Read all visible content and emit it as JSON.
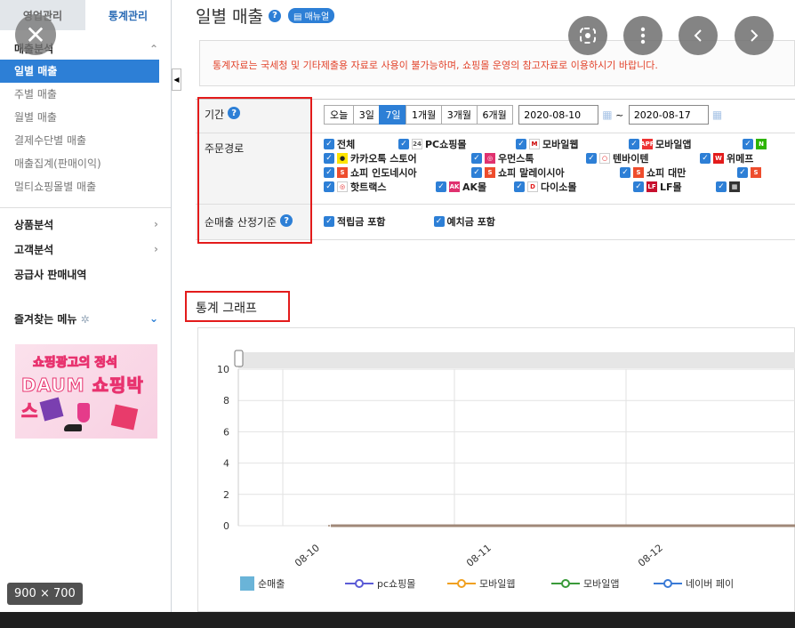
{
  "sidebar": {
    "tabs": [
      "영업관리",
      "통계관리"
    ],
    "section_sales": "매출분석",
    "items": [
      "일별 매출",
      "주별 매출",
      "월별 매출",
      "결제수단별 매출",
      "매출집계(판매이익)",
      "멀티쇼핑몰별 매출"
    ],
    "sections": [
      "상품분석",
      "고객분석",
      "공급사 판매내역"
    ],
    "favorites": "즐겨찾는 메뉴",
    "banner_line1": "쇼핑광고의 정석",
    "banner_line2": "DAUM 쇼핑박스"
  },
  "main": {
    "title": "일별 매출",
    "manual": "매뉴얼",
    "notice": "통계자료는 국세청 및 기타제출용 자료로 사용이 불가능하며, 쇼핑몰 운영의 참고자료로 이용하시기 바랍니다.",
    "period_label": "기간",
    "period_buttons": [
      "오늘",
      "3일",
      "7일",
      "1개월",
      "3개월",
      "6개월"
    ],
    "active_period": "7일",
    "date_from": "2020-08-10",
    "date_sep": "~",
    "date_to": "2020-08-17",
    "channel_label": "주문경로",
    "channels": [
      [
        "전체",
        "PC쇼핑몰",
        "모바일웹",
        "모바일앱"
      ],
      [
        "카카오톡 스토어",
        "우먼스톡",
        "텐바이텐",
        "위메프"
      ],
      [
        "쇼피 인도네시아",
        "쇼피 말레이시아",
        "쇼피 대만"
      ],
      [
        "핫트랙스",
        "AK몰",
        "다이소몰",
        "LF몰"
      ]
    ],
    "net_label": "순매출 산정기준",
    "net_options": [
      "적립금 포함",
      "예치금 포함"
    ],
    "graph_title": "통계 그래프"
  },
  "chart_data": {
    "type": "line",
    "x": [
      "08-10",
      "08-11",
      "08-12"
    ],
    "ylim": [
      0,
      10
    ],
    "yticks": [
      0,
      2,
      4,
      6,
      8,
      10
    ],
    "series": [
      {
        "name": "순매출",
        "values": [
          0,
          0,
          0
        ]
      }
    ],
    "legend": [
      "순매출",
      "pc쇼핑몰",
      "모바일웹",
      "모바일앱",
      "네이버 페이"
    ],
    "legend_colors": [
      "#6ab4d8",
      "#5b5bd6",
      "#f0a020",
      "#3a9a3a",
      "#3a7ad6"
    ]
  },
  "overlay": {
    "dimensions": "900 × 700"
  }
}
